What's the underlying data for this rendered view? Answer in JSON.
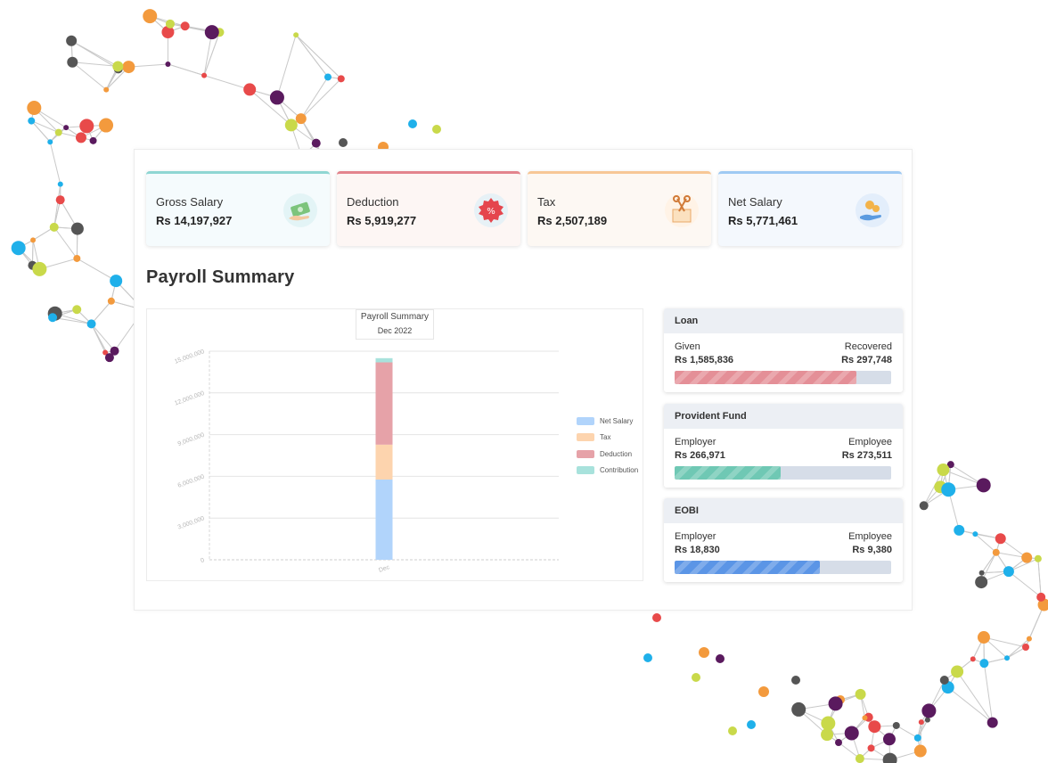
{
  "cards": [
    {
      "label": "Gross Salary",
      "value": "Rs 14,197,927",
      "color": "#8fd6d3",
      "bg": "#f5fbfd",
      "icon": "money-hand-icon"
    },
    {
      "label": "Deduction",
      "value": "Rs 5,919,277",
      "color": "#e3848d",
      "bg": "#fdf6f4",
      "icon": "percent-badge-icon"
    },
    {
      "label": "Tax",
      "value": "Rs 2,507,189",
      "color": "#f7c796",
      "bg": "#fdf8f3",
      "icon": "scissors-tax-icon"
    },
    {
      "label": "Net Salary",
      "value": "Rs 5,771,461",
      "color": "#9fcaf3",
      "bg": "#f4f8fd",
      "icon": "coins-hand-icon"
    }
  ],
  "section_title": "Payroll Summary",
  "chart_data": {
    "type": "bar",
    "stacked": true,
    "title": "Payroll Summary",
    "subtitle": "Dec 2022",
    "categories": [
      "Dec"
    ],
    "ylim": [
      0,
      15000000
    ],
    "yticks": [
      "0",
      "3,000,000",
      "6,000,000",
      "9,000,000",
      "12,000,000",
      "15,000,000"
    ],
    "grid": true,
    "legend_position": "right",
    "series": [
      {
        "name": "Net Salary",
        "values": [
          5771461
        ],
        "color": "#b1d4fb"
      },
      {
        "name": "Tax",
        "values": [
          2507189
        ],
        "color": "#fdd4ae"
      },
      {
        "name": "Deduction",
        "values": [
          5919277
        ],
        "color": "#e6a2a8"
      },
      {
        "name": "Contribution",
        "values": [
          300000
        ],
        "color": "#a8e2dc"
      }
    ]
  },
  "loan": {
    "title": "Loan",
    "left_label": "Given",
    "right_label": "Recovered",
    "left_value": "Rs 1,585,836",
    "right_value": "Rs 297,748",
    "fill_fraction": 0.84,
    "color": "#e48f97"
  },
  "provident_fund": {
    "title": "Provident Fund",
    "left_label": "Employer",
    "right_label": "Employee",
    "left_value": "Rs 266,971",
    "right_value": "Rs 273,511",
    "fill_fraction": 0.49,
    "color": "#6fc8b4"
  },
  "eobi": {
    "title": "EOBI",
    "left_label": "Employer",
    "right_label": "Employee",
    "left_value": "Rs 18,830",
    "right_value": "Rs 9,380",
    "fill_fraction": 0.67,
    "color": "#5b95e6"
  }
}
